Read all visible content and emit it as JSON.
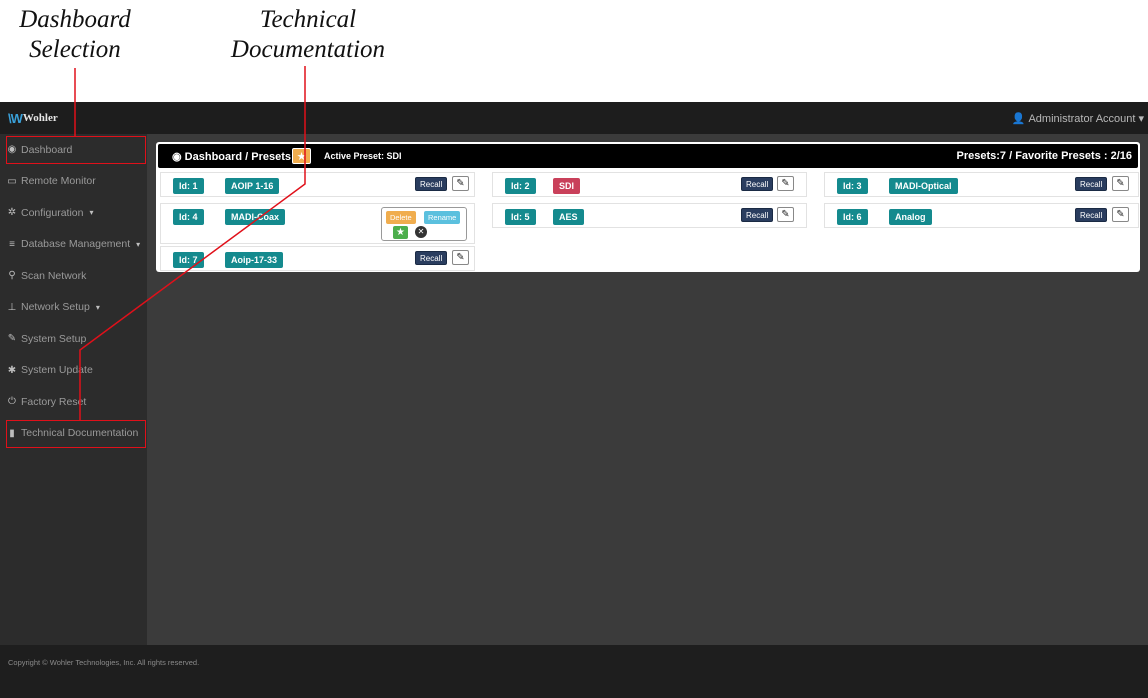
{
  "annotations": {
    "dashboard_selection": [
      "Dashboard",
      "Selection"
    ],
    "technical_documentation": [
      "Technical",
      "Documentation"
    ]
  },
  "topbar": {
    "logo_text": "Wohler",
    "account_label": "Administrator Account"
  },
  "sidebar": {
    "items": [
      {
        "label": "Dashboard",
        "icon": "dashboard-icon",
        "glyph": "◉"
      },
      {
        "label": "Remote Monitor",
        "icon": "monitor-icon",
        "glyph": "▭"
      },
      {
        "label": "Configuration",
        "icon": "cogs-icon",
        "glyph": "✲",
        "caret": true
      },
      {
        "label": "Database Management",
        "icon": "database-icon",
        "glyph": "≡",
        "caret": true
      },
      {
        "label": "Scan Network",
        "icon": "search-icon",
        "glyph": "⚲"
      },
      {
        "label": "Network Setup",
        "icon": "sitemap-icon",
        "glyph": "⊥",
        "caret": true
      },
      {
        "label": "System Setup",
        "icon": "wrench-icon",
        "glyph": "✎"
      },
      {
        "label": "System Update",
        "icon": "gear-icon",
        "glyph": "✱"
      },
      {
        "label": "Factory Reset",
        "icon": "power-icon",
        "glyph": "⏻"
      },
      {
        "label": "Technical Documentation",
        "icon": "book-icon",
        "glyph": "▮"
      }
    ]
  },
  "panel": {
    "title": "Dashboard / Presets",
    "active_preset": "Active Preset: SDI",
    "summary": "Presets:7 / Favorite Presets : 2/16"
  },
  "presets": [
    {
      "id": "Id: 1",
      "name": "AOIP 1-16",
      "active": false
    },
    {
      "id": "Id: 2",
      "name": "SDI",
      "active": true
    },
    {
      "id": "Id: 3",
      "name": "MADI-Optical",
      "active": false
    },
    {
      "id": "Id: 4",
      "name": "MADI-Coax",
      "active": false,
      "editing": true
    },
    {
      "id": "Id: 5",
      "name": "AES",
      "active": false
    },
    {
      "id": "Id: 6",
      "name": "Analog",
      "active": false
    },
    {
      "id": "Id: 7",
      "name": "Aoip-17-33",
      "active": false
    }
  ],
  "buttons": {
    "recall": "Recall",
    "delete": "Delete",
    "rename": "Rename"
  },
  "footer": {
    "copyright": "Copyright © Wohler Technologies, Inc. All rights reserved."
  },
  "colors": {
    "highlight": "#e0101a",
    "chip": "#148a8e",
    "active_chip": "#c9405a"
  }
}
